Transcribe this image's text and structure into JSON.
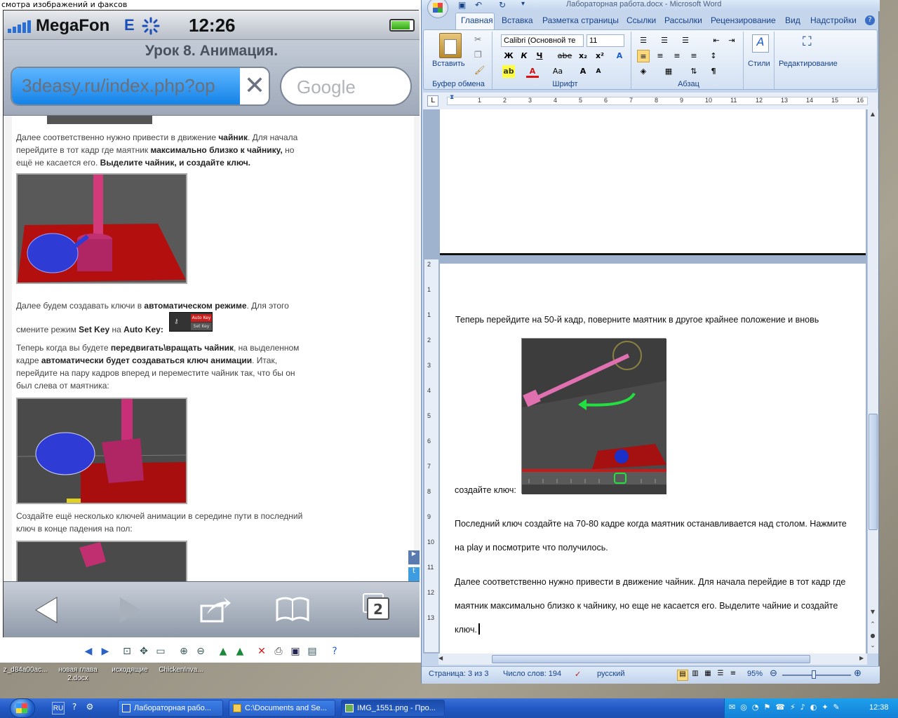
{
  "viewer": {
    "title": "смотра изображений и факсов",
    "status": {
      "carrier": "MegaFon",
      "network": "E",
      "time": "12:26"
    },
    "page_title": "Урок 8. Анимация.",
    "url": "3deasy.ru/index.php?op",
    "search_placeholder": "Google",
    "tabs_count": "2",
    "content": {
      "p1_a": "Далее соответственно нужно привести в движение ",
      "p1_b": "чайник",
      "p1_c": ". Для начала",
      "p1_d": "перейдите в тот кадр где маятник ",
      "p1_e": "максимально близко к чайнику,",
      "p1_f": " но",
      "p1_g": "ещё не касается его. ",
      "p1_h": "Выделите чайник, и создайте ключ.",
      "p2_a": "Далее будем создавать ключи в ",
      "p2_b": "автоматическом режиме",
      "p2_c": ". Для этого",
      "p2_d": "смените режим ",
      "p2_e": "Set Key",
      "p2_f": " на ",
      "p2_g": "Auto Key:",
      "autokey_label": "Auto Key",
      "setkey_label": "Set Key",
      "p3_a": "Теперь когда вы будете ",
      "p3_b": "передвигать\\вращать чайник",
      "p3_c": ", на выделенном",
      "p3_d": "кадре ",
      "p3_e": "автоматически будет создаваться ключ анимации",
      "p3_f": ". Итак,",
      "p3_g": "перейдите на пару кадров вперед и переместите чайник так, что бы он",
      "p3_h": "был слева от маятника:",
      "p4_a": "Создайте ещё несколько ключей анимации в середине пути в последний",
      "p4_b": "ключ в конце падения на пол:"
    }
  },
  "desktop_icons": [
    {
      "label": "z_d84a00ac..."
    },
    {
      "label": "новая глава 2.docx"
    },
    {
      "label": "исходящие"
    },
    {
      "label": "ChickenInva..."
    }
  ],
  "word": {
    "title": "Лабораторная работа.docx - Microsoft Word",
    "tabs": [
      "Главная",
      "Вставка",
      "Разметка страницы",
      "Ссылки",
      "Рассылки",
      "Рецензирование",
      "Вид",
      "Надстройки"
    ],
    "font_name": "Calibri (Основной те",
    "font_size": "11",
    "groups": {
      "clipboard": "Буфер обмена",
      "font": "Шрифт",
      "paragraph": "Абзац",
      "styles": "Стили",
      "editing": "Редактирование",
      "paste": "Вставить"
    },
    "font_buttons": {
      "bold": "Ж",
      "italic": "К",
      "underline": "Ч",
      "strike": "abe",
      "sub": "x₂",
      "sup": "x²",
      "case": "Aa"
    },
    "ruler_ticks": [
      "1",
      "2",
      "3",
      "4",
      "5",
      "6",
      "7",
      "8",
      "9",
      "10",
      "11",
      "12",
      "13",
      "14",
      "15",
      "16"
    ],
    "vruler_ticks": [
      "2",
      "1",
      "1",
      "2",
      "3",
      "4",
      "5",
      "6",
      "7",
      "8",
      "9",
      "10",
      "11",
      "12",
      "13"
    ],
    "doc": {
      "line1": "Теперь перейдите на 50-й кадр, поверните маятник в другое  крайнее положение и вновь",
      "line2": "создайте ключ:",
      "line3": "Последний  ключ создайте  на 70-80 кадре когда маятник останавливается над столом.   Нажмите",
      "line4": "на play и посмотрите  что получилось.",
      "line5": "Далее соответственно  нужно привести в движение чайник. Для начала перейдие в тот кадр где",
      "line6": "маятник максимально  близко к чайнику, но еще не касается его. Выделите чайние и создайте",
      "line7": "ключ."
    },
    "status": {
      "page": "Страница: 3 из 3",
      "words": "Число слов: 194",
      "lang": "русский",
      "zoom": "95%"
    }
  },
  "taskbar": {
    "lang": "RU",
    "tasks": [
      "Лабораторная рабо...",
      "C:\\Documents and Se...",
      "IMG_1551.png - Про..."
    ],
    "clock": "12:38"
  },
  "colors": {
    "word_blue": "#15428b",
    "ios_blue": "#1583e8",
    "taskbar": "#2158c4"
  }
}
